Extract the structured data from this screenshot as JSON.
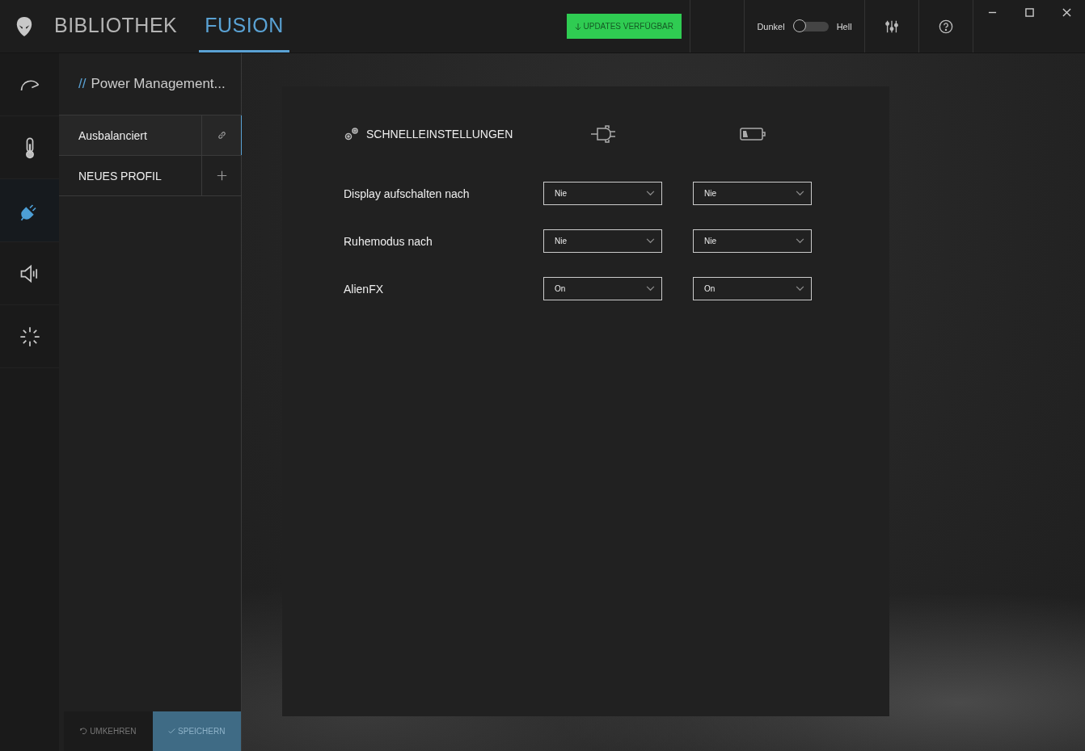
{
  "header": {
    "tabs": [
      {
        "label": "BIBLIOTHEK",
        "selected": false
      },
      {
        "label": "FUSION",
        "selected": true
      }
    ],
    "update_button": "UPDATES VERFÜGBAR",
    "theme_toggle": {
      "left_label": "Dunkel",
      "right_label": "Hell",
      "on": false
    }
  },
  "rail": [
    {
      "kind": "gauge",
      "selected": false
    },
    {
      "kind": "thermometer",
      "selected": false
    },
    {
      "kind": "plug",
      "selected": true
    },
    {
      "kind": "speaker",
      "selected": false
    },
    {
      "kind": "lights",
      "selected": false
    }
  ],
  "profile_panel": {
    "title_prefix": "//",
    "title": "Power Management...",
    "profiles": [
      {
        "label": "Ausbalanciert",
        "kind": "link",
        "selected": true
      },
      {
        "label": "NEUES PROFIL",
        "kind": "add",
        "selected": false
      }
    ],
    "revert_button": "UMKEHREN",
    "save_button": "SPEICHERN"
  },
  "quick_settings": {
    "title": "SCHNELLEINSTELLUNGEN",
    "rows": [
      {
        "label": "Display aufschalten nach",
        "plugged": "Nie",
        "battery": "Nie"
      },
      {
        "label": "Ruhemodus nach",
        "plugged": "Nie",
        "battery": "Nie"
      },
      {
        "label": "AlienFX",
        "plugged": "On",
        "battery": "On"
      }
    ]
  }
}
